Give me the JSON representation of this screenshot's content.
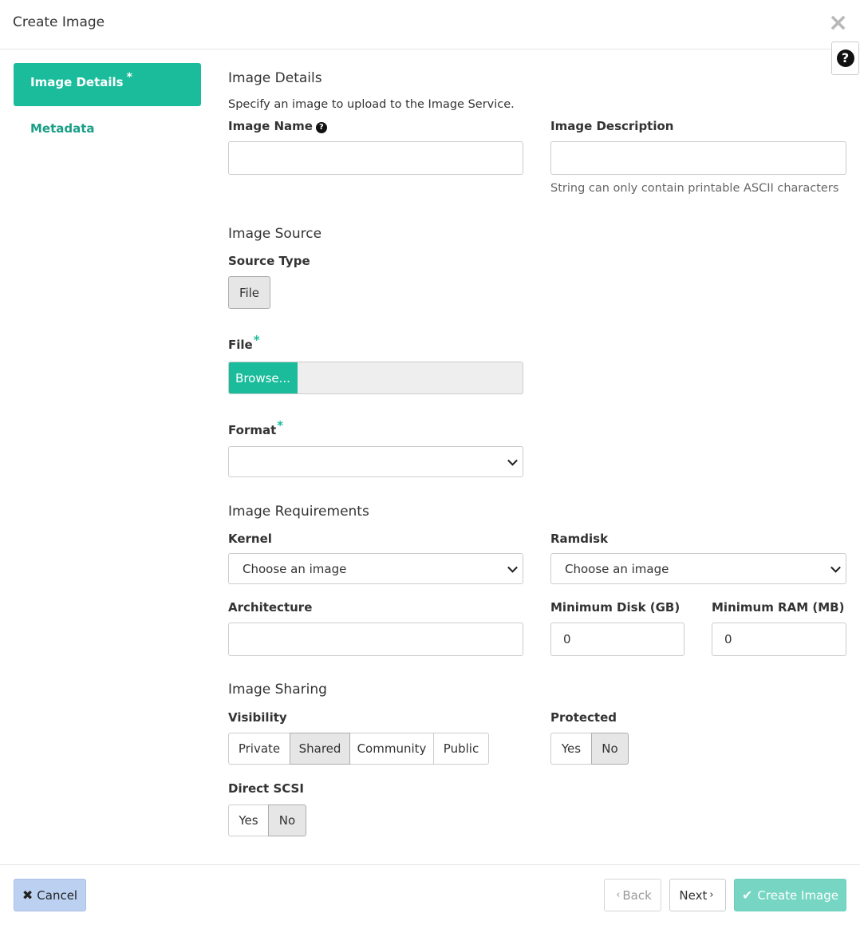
{
  "modal": {
    "title": "Create Image",
    "close_icon": "×",
    "help_icon": "?"
  },
  "nav": {
    "items": [
      {
        "label": "Image Details",
        "required_marker": "*",
        "active": true
      },
      {
        "label": "Metadata",
        "active": false
      }
    ]
  },
  "details": {
    "section_title": "Image Details",
    "help_text": "Specify an image to upload to the Image Service.",
    "image_name": {
      "label": "Image Name",
      "value": "",
      "icon": "question-circle-icon"
    },
    "image_description": {
      "label": "Image Description",
      "value": "",
      "hint": "String can only contain printable ASCII characters"
    }
  },
  "source": {
    "section_title": "Image Source",
    "source_type_label": "Source Type",
    "source_type_options": [
      "File"
    ],
    "source_type_selected": "File",
    "file_label": "File",
    "required_marker": "*",
    "browse_label": "Browse...",
    "file_value": "",
    "format_label": "Format",
    "format_value": ""
  },
  "requirements": {
    "section_title": "Image Requirements",
    "kernel_label": "Kernel",
    "kernel_value": "Choose an image",
    "ramdisk_label": "Ramdisk",
    "ramdisk_value": "Choose an image",
    "architecture_label": "Architecture",
    "architecture_value": "",
    "min_disk_label": "Minimum Disk (GB)",
    "min_disk_value": "0",
    "min_ram_label": "Minimum RAM (MB)",
    "min_ram_value": "0"
  },
  "sharing": {
    "section_title": "Image Sharing",
    "visibility_label": "Visibility",
    "visibility_options": [
      "Private",
      "Shared",
      "Community",
      "Public"
    ],
    "visibility_selected": "Shared",
    "protected_label": "Protected",
    "protected_options": [
      "Yes",
      "No"
    ],
    "protected_selected": "No",
    "direct_scsi_label": "Direct SCSI",
    "direct_scsi_options": [
      "Yes",
      "No"
    ],
    "direct_scsi_selected": "No"
  },
  "footer": {
    "cancel_label": "Cancel",
    "back_label": "Back",
    "next_label": "Next",
    "create_label": "Create Image"
  },
  "colors": {
    "accent": "#1bbc9b",
    "cancel_bg": "#bcd1f2",
    "create_disabled_bg": "#76d6c3"
  }
}
